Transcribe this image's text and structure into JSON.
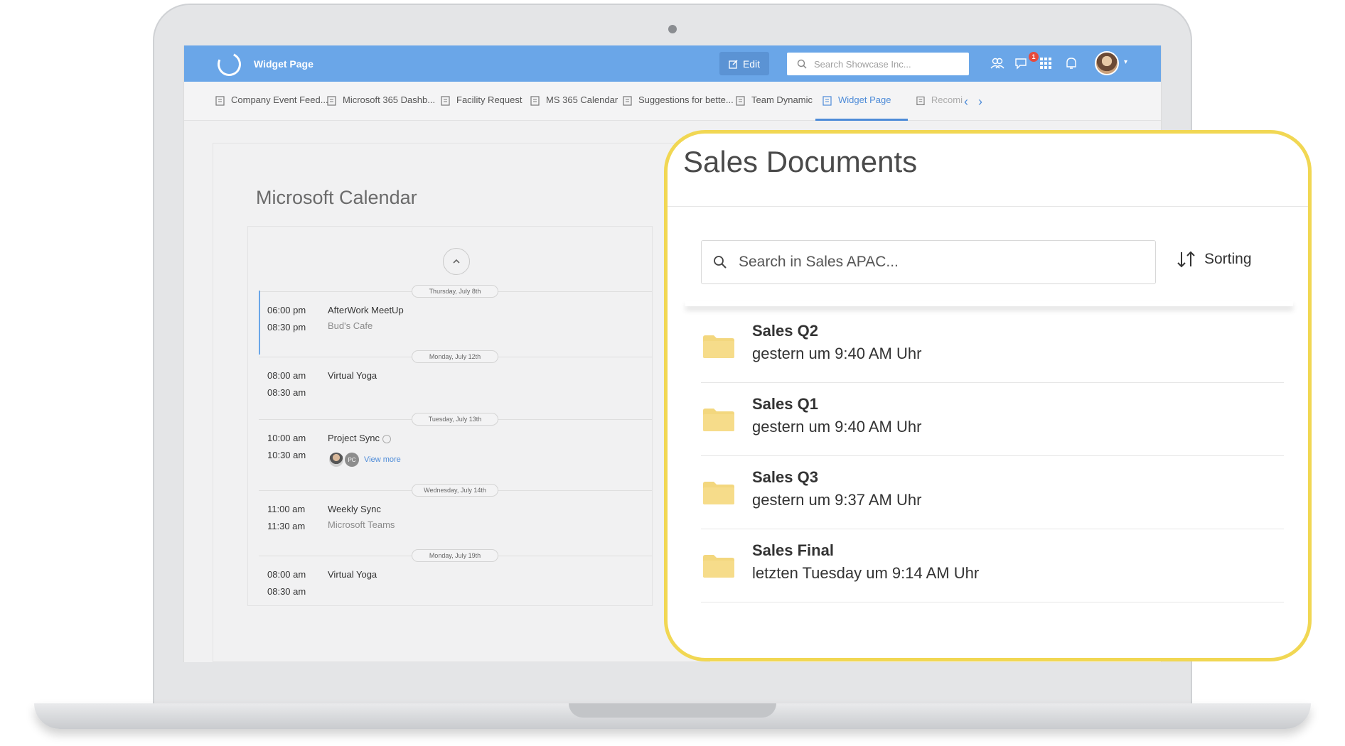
{
  "app": {
    "title": "Widget Page",
    "edit_label": "Edit",
    "search_placeholder": "Search Showcase Inc...",
    "notification_count": "1",
    "accent_color": "#6aa6e8"
  },
  "tabs": [
    {
      "label": "Company Event Feed..."
    },
    {
      "label": "Microsoft 365 Dashb..."
    },
    {
      "label": "Facility Request"
    },
    {
      "label": "MS 365 Calendar"
    },
    {
      "label": "Suggestions for bette..."
    },
    {
      "label": "Team Dynamic"
    },
    {
      "label": "Widget Page"
    },
    {
      "label": "Recomi"
    }
  ],
  "calendar": {
    "title": "Microsoft Calendar",
    "days": [
      {
        "label": "Thursday, July 8th"
      },
      {
        "label": "Monday, July 12th"
      },
      {
        "label": "Tuesday, July 13th"
      },
      {
        "label": "Wednesday, July 14th"
      },
      {
        "label": "Monday, July 19th"
      }
    ],
    "events": [
      {
        "start": "06:00 pm",
        "end": "08:30 pm",
        "title": "AfterWork MeetUp",
        "location": "Bud's Cafe"
      },
      {
        "start": "08:00 am",
        "end": "08:30 am",
        "title": "Virtual Yoga",
        "location": ""
      },
      {
        "start": "10:00 am",
        "end": "10:30 am",
        "title": "Project Sync",
        "location": "",
        "attendee_initials": "PC",
        "view_more": "View more"
      },
      {
        "start": "11:00 am",
        "end": "11:30 am",
        "title": "Weekly Sync",
        "location": "Microsoft Teams"
      },
      {
        "start": "08:00 am",
        "end": "08:30 am",
        "title": "Virtual Yoga",
        "location": ""
      }
    ]
  },
  "sales": {
    "title": "Sales Documents",
    "search_placeholder": "Search in Sales APAC...",
    "sorting_label": "Sorting",
    "highlight_color": "#f1d753",
    "items": [
      {
        "name": "Sales Q2",
        "date": "gestern um 9:40 AM Uhr"
      },
      {
        "name": "Sales Q1",
        "date": "gestern um 9:40 AM Uhr"
      },
      {
        "name": "Sales Q3",
        "date": "gestern um 9:37 AM Uhr"
      },
      {
        "name": "Sales Final",
        "date": "letzten Tuesday um 9:14 AM Uhr"
      }
    ]
  }
}
